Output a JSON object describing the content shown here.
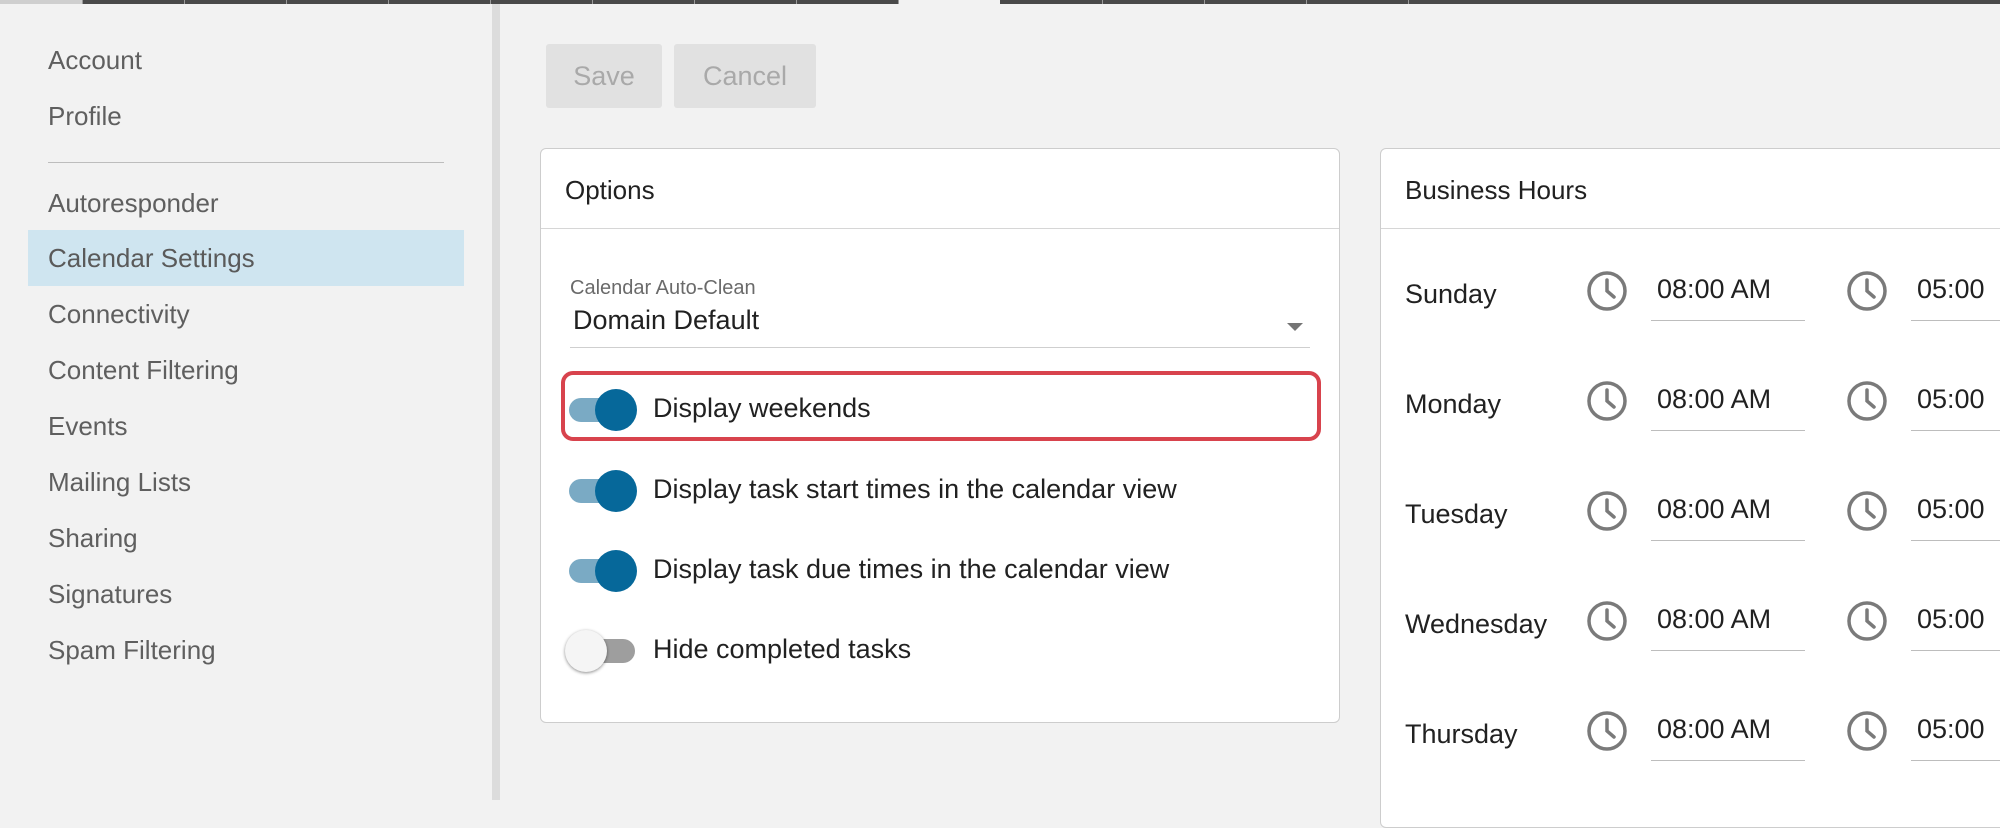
{
  "sidebar": {
    "items": [
      {
        "label": "Account"
      },
      {
        "label": "Profile"
      },
      {
        "label": "Autoresponder"
      },
      {
        "label": "Calendar Settings",
        "active": true
      },
      {
        "label": "Connectivity"
      },
      {
        "label": "Content Filtering"
      },
      {
        "label": "Events"
      },
      {
        "label": "Mailing Lists"
      },
      {
        "label": "Sharing"
      },
      {
        "label": "Signatures"
      },
      {
        "label": "Spam Filtering"
      }
    ]
  },
  "toolbar": {
    "save_label": "Save",
    "cancel_label": "Cancel"
  },
  "options": {
    "title": "Options",
    "auto_clean": {
      "label": "Calendar Auto-Clean",
      "value": "Domain Default"
    },
    "toggles": [
      {
        "label": "Display weekends",
        "on": true,
        "highlighted": true
      },
      {
        "label": "Display task start times in the calendar view",
        "on": true
      },
      {
        "label": "Display task due times in the calendar view",
        "on": true
      },
      {
        "label": "Hide completed tasks",
        "on": false
      }
    ]
  },
  "business_hours": {
    "title": "Business Hours",
    "days": [
      {
        "day": "Sunday",
        "start": "08:00 AM",
        "end": "05:00"
      },
      {
        "day": "Monday",
        "start": "08:00 AM",
        "end": "05:00"
      },
      {
        "day": "Tuesday",
        "start": "08:00 AM",
        "end": "05:00"
      },
      {
        "day": "Wednesday",
        "start": "08:00 AM",
        "end": "05:00"
      },
      {
        "day": "Thursday",
        "start": "08:00 AM",
        "end": "05:00"
      }
    ]
  },
  "colors": {
    "accent": "#06689a",
    "toggle_track_on": "#7aaac4",
    "active_nav_bg": "#cfe5f0",
    "highlight_border": "#d8434d"
  }
}
